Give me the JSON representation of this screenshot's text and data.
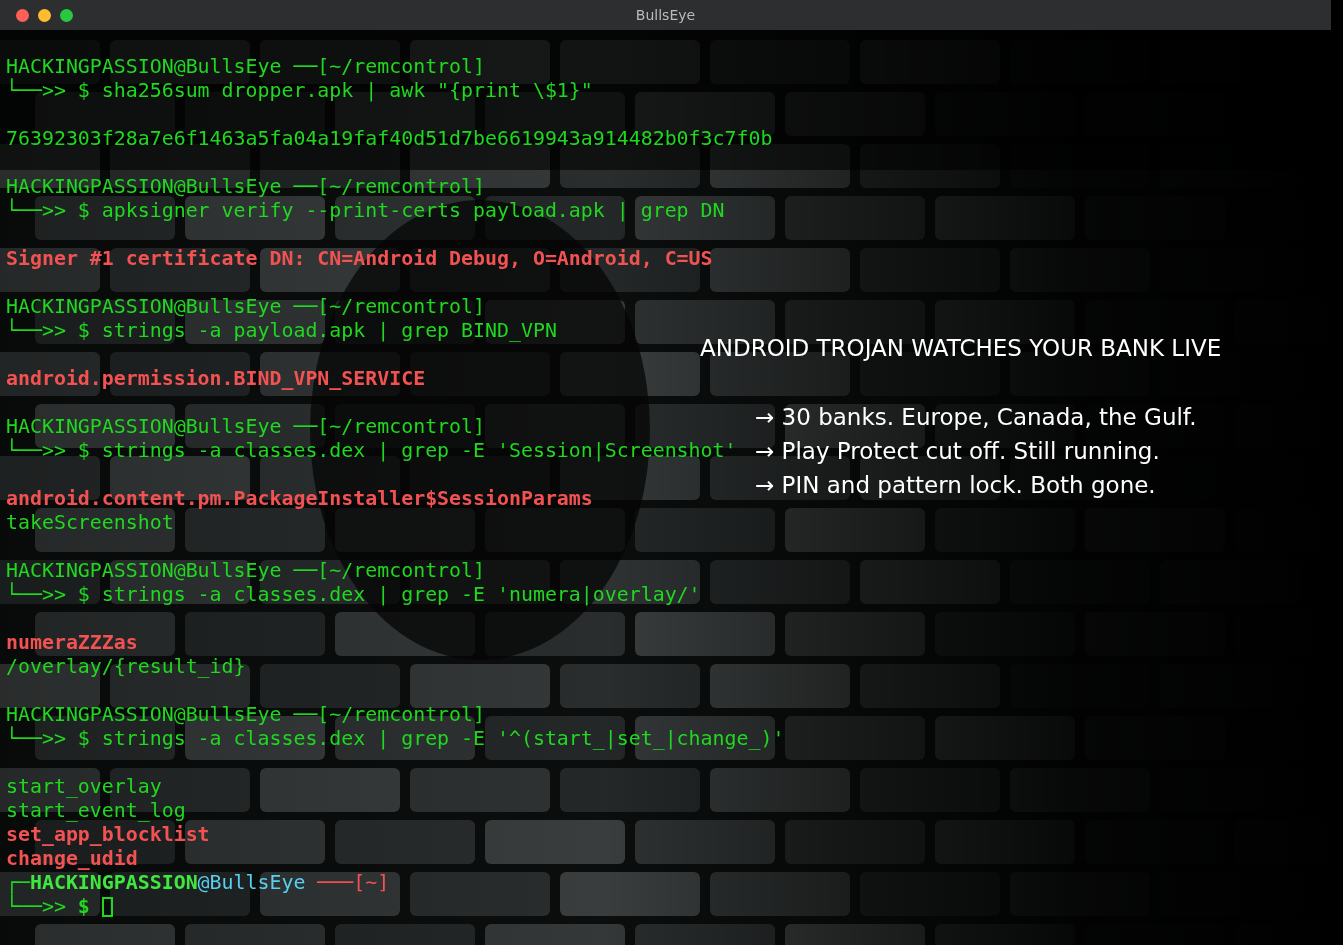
{
  "window": {
    "title": "BullsEye"
  },
  "terminal": {
    "blocks": [
      {
        "prompt": "HACKINGPASSION@BullsEye ──[~/remcontrol]",
        "command": "└──>> $ sha256sum dropper.apk | awk \"{print \\$1}\"",
        "outputs": [
          {
            "text": "76392303f28a7e6f1463a5fa04a19faf40d51d7be6619943a914482b0f3c7f0b",
            "kind": "normal"
          }
        ]
      },
      {
        "prompt": "HACKINGPASSION@BullsEye ──[~/remcontrol]",
        "command": "└──>> $ apksigner verify --print-certs payload.apk | grep DN",
        "outputs": [
          {
            "text": "Signer #1 certificate DN: CN=Android Debug, O=Android, C=US",
            "kind": "highlight"
          }
        ]
      },
      {
        "prompt": "HACKINGPASSION@BullsEye ──[~/remcontrol]",
        "command": "└──>> $ strings -a payload.apk | grep BIND_VPN",
        "outputs": [
          {
            "text": "android.permission.BIND_VPN_SERVICE",
            "kind": "highlight"
          }
        ]
      },
      {
        "prompt": "HACKINGPASSION@BullsEye ──[~/remcontrol]",
        "command": "└──>> $ strings -a classes.dex | grep -E 'Session|Screenshot'",
        "outputs": [
          {
            "text": "android.content.pm.PackageInstaller$SessionParams",
            "kind": "highlight"
          },
          {
            "text": "takeScreenshot",
            "kind": "normal"
          }
        ]
      },
      {
        "prompt": "HACKINGPASSION@BullsEye ──[~/remcontrol]",
        "command": "└──>> $ strings -a classes.dex | grep -E 'numera|overlay/'",
        "outputs": [
          {
            "text": "numeraZZZas",
            "kind": "highlight"
          },
          {
            "text": "/overlay/{result_id}",
            "kind": "normal"
          }
        ]
      },
      {
        "prompt": "HACKINGPASSION@BullsEye ──[~/remcontrol]",
        "command": "└──>> $ strings -a classes.dex | grep -E '^(start_|set_|change_)'",
        "outputs": [
          {
            "text": "start_overlay",
            "kind": "normal"
          },
          {
            "text": "start_event_log",
            "kind": "normal"
          },
          {
            "text": "set_app_blocklist",
            "kind": "highlight"
          },
          {
            "text": "change_udid",
            "kind": "highlight"
          }
        ]
      }
    ],
    "final_prompt": [
      {
        "text": "┌─",
        "kind": "frame"
      },
      {
        "text": "HACKINGPASSION",
        "kind": "user"
      },
      {
        "text": "@BullsEye",
        "kind": "host"
      },
      {
        "text": " ───[~]",
        "kind": "path"
      }
    ],
    "final_input": [
      {
        "text": "└──>>",
        "kind": "frame"
      },
      {
        "text": " $",
        "kind": "dollar"
      }
    ]
  },
  "overlay": {
    "headline": "ANDROID TROJAN WATCHES YOUR BANK LIVE",
    "bullets": [
      "→ 30 banks. Europe, Canada, the Gulf.",
      "→ Play Protect cut off. Still running.",
      "→ PIN and pattern lock. Both gone."
    ]
  }
}
